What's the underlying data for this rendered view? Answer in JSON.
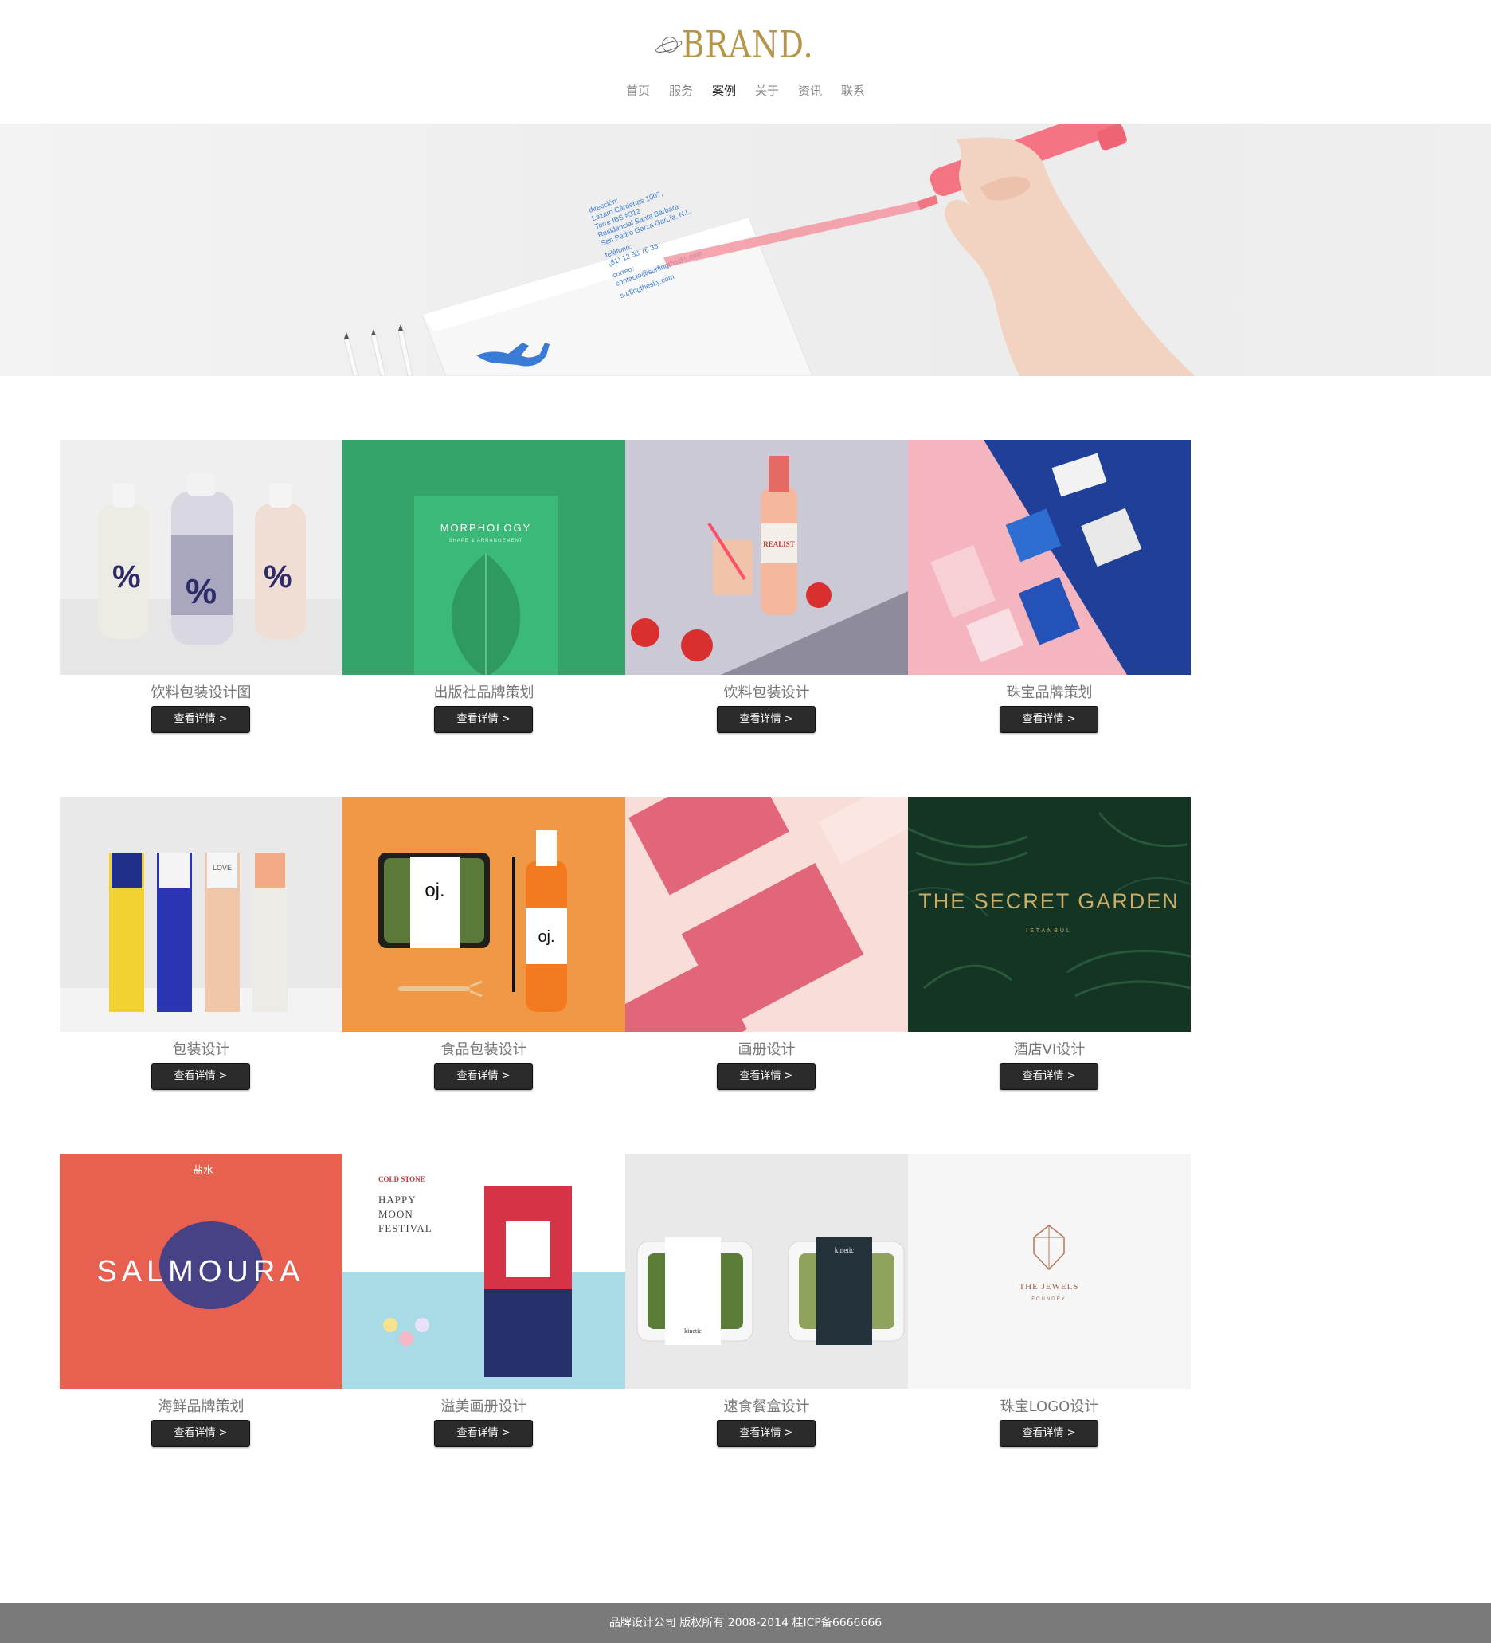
{
  "brand": {
    "name": "BRAND.",
    "color": "#b4954a"
  },
  "nav": [
    {
      "label": "首页",
      "active": false
    },
    {
      "label": "服务",
      "active": false
    },
    {
      "label": "案例",
      "active": true
    },
    {
      "label": "关于",
      "active": false
    },
    {
      "label": "资讯",
      "active": false
    },
    {
      "label": "联系",
      "active": false
    }
  ],
  "hero": {
    "card_lines": [
      "dirección:",
      "Lázaro Cárdenas 1007,",
      "Torre IBS #312",
      "Residencial Santa Bárbara",
      "San Pedro Garza García, N.L.",
      "teléfono:",
      "(81) 12 53 76 38",
      "correo:",
      "contacto@surfingthesky.com",
      "surfingthesky.com"
    ]
  },
  "cases": [
    {
      "title": "饮料包装设计图",
      "button": "查看详情 >",
      "art": {
        "caption": "",
        "bg": "#f0f0f0"
      }
    },
    {
      "title": "出版社品牌策划",
      "button": "查看详情 >",
      "art": {
        "caption": "MORPHOLOGY",
        "sub": "SHAPE & ARRANGEMENT",
        "bg": "#35a46a"
      }
    },
    {
      "title": "饮料包装设计",
      "button": "查看详情 >",
      "art": {
        "caption": "REALIST",
        "bg": "#c9c7d4"
      }
    },
    {
      "title": "珠宝品牌策划",
      "button": "查看详情 >",
      "art": {
        "caption": "",
        "bg": "#f4b5be"
      }
    },
    {
      "title": "包装设计",
      "button": "查看详情 >",
      "art": {
        "caption": "LOVE",
        "bg": "#e9e9e9"
      }
    },
    {
      "title": "食品包装设计",
      "button": "查看详情 >",
      "art": {
        "caption": "oj.",
        "bg": "#f09845"
      }
    },
    {
      "title": "画册设计",
      "button": "查看详情 >",
      "art": {
        "caption": "",
        "bg": "#f9ddd8"
      }
    },
    {
      "title": "酒店VI设计",
      "button": "查看详情 >",
      "art": {
        "caption": "THE SECRET GARDEN",
        "sub": "ISTANBUL",
        "bg": "#143424"
      }
    },
    {
      "title": "海鲜品牌策划",
      "button": "查看详情 >",
      "art": {
        "caption": "SALMOURA",
        "sub": "盐水",
        "bg": "#e8604f"
      }
    },
    {
      "title": "溢美画册设计",
      "button": "查看详情 >",
      "art": {
        "caption": "HAPPY MOON FESTIVAL",
        "sub": "COLD STONE",
        "bg": "#ffffff"
      }
    },
    {
      "title": "速食餐盒设计",
      "button": "查看详情 >",
      "art": {
        "caption": "kinetic",
        "bg": "#e9e9e9"
      }
    },
    {
      "title": "珠宝LOGO设计",
      "button": "查看详情 >",
      "art": {
        "caption": "THE JEWELS",
        "sub": "FOUNDRY",
        "bg": "#f6f6f6"
      }
    }
  ],
  "footer": {
    "text": "品牌设计公司 版权所有 2008-2014 桂ICP备6666666"
  }
}
